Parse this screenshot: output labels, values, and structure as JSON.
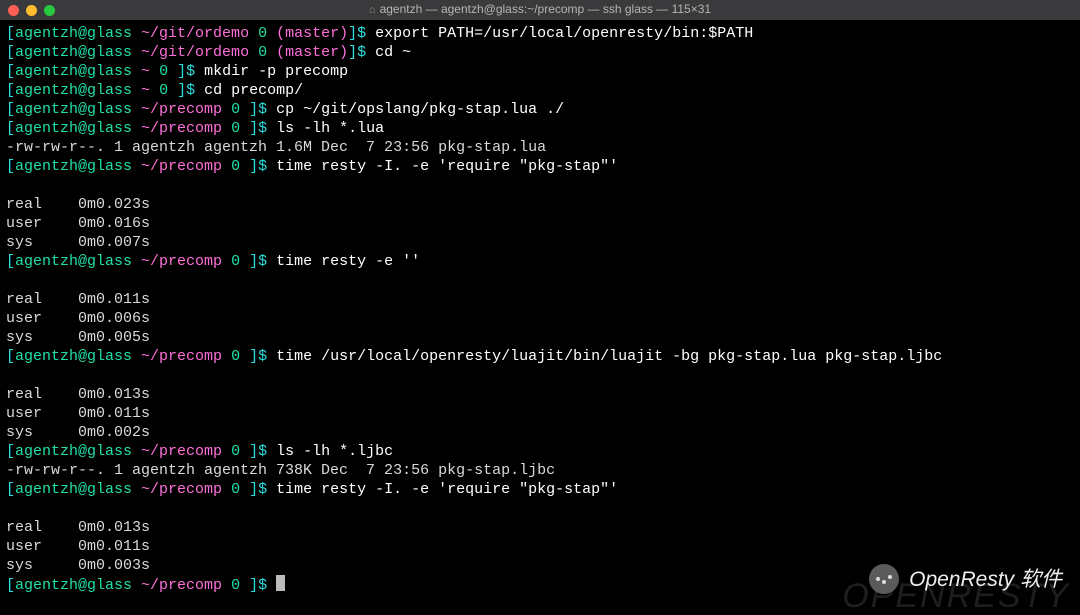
{
  "window": {
    "title": "agentzh — agentzh@glass:~/precomp — ssh glass — 115×31"
  },
  "prompt_parts": {
    "open": "[",
    "userhost": "agentzh@glass ",
    "sep1": "~/",
    "idx": "0 ",
    "close": "]",
    "dollar": "$ "
  },
  "lines": [
    {
      "t": "prompt",
      "path": "git/ordemo ",
      "branch": "(master)",
      "cmd": "export PATH=/usr/local/openresty/bin:$PATH"
    },
    {
      "t": "prompt",
      "path": "git/ordemo ",
      "branch": "(master)",
      "cmd": "cd ~"
    },
    {
      "t": "prompt2",
      "path": "~ ",
      "cmd": "mkdir -p precomp"
    },
    {
      "t": "prompt2",
      "path": "~ ",
      "cmd": "cd precomp/"
    },
    {
      "t": "prompt",
      "path": "precomp ",
      "cmd": "cp ~/git/opslang/pkg-stap.lua ./"
    },
    {
      "t": "prompt",
      "path": "precomp ",
      "cmd": "ls -lh *.lua"
    },
    {
      "t": "out",
      "text": "-rw-rw-r--. 1 agentzh agentzh 1.6M Dec  7 23:56 pkg-stap.lua"
    },
    {
      "t": "prompt",
      "path": "precomp ",
      "cmd": "time resty -I. -e 'require \"pkg-stap\"'"
    },
    {
      "t": "blank"
    },
    {
      "t": "out",
      "text": "real    0m0.023s"
    },
    {
      "t": "out",
      "text": "user    0m0.016s"
    },
    {
      "t": "out",
      "text": "sys     0m0.007s"
    },
    {
      "t": "prompt",
      "path": "precomp ",
      "cmd": "time resty -e ''"
    },
    {
      "t": "blank"
    },
    {
      "t": "out",
      "text": "real    0m0.011s"
    },
    {
      "t": "out",
      "text": "user    0m0.006s"
    },
    {
      "t": "out",
      "text": "sys     0m0.005s"
    },
    {
      "t": "prompt",
      "path": "precomp ",
      "cmd": "time /usr/local/openresty/luajit/bin/luajit -bg pkg-stap.lua pkg-stap.ljbc"
    },
    {
      "t": "blank"
    },
    {
      "t": "out",
      "text": "real    0m0.013s"
    },
    {
      "t": "out",
      "text": "user    0m0.011s"
    },
    {
      "t": "out",
      "text": "sys     0m0.002s"
    },
    {
      "t": "prompt",
      "path": "precomp ",
      "cmd": "ls -lh *.ljbc"
    },
    {
      "t": "out",
      "text": "-rw-rw-r--. 1 agentzh agentzh 738K Dec  7 23:56 pkg-stap.ljbc"
    },
    {
      "t": "prompt",
      "path": "precomp ",
      "cmd": "time resty -I. -e 'require \"pkg-stap\"'"
    },
    {
      "t": "blank"
    },
    {
      "t": "out",
      "text": "real    0m0.013s"
    },
    {
      "t": "out",
      "text": "user    0m0.011s"
    },
    {
      "t": "out",
      "text": "sys     0m0.003s"
    },
    {
      "t": "prompt",
      "path": "precomp ",
      "cmd": "",
      "cursor": true
    }
  ],
  "watermark": {
    "text": "OpenResty 软件",
    "faint": "OPENRESTY"
  }
}
